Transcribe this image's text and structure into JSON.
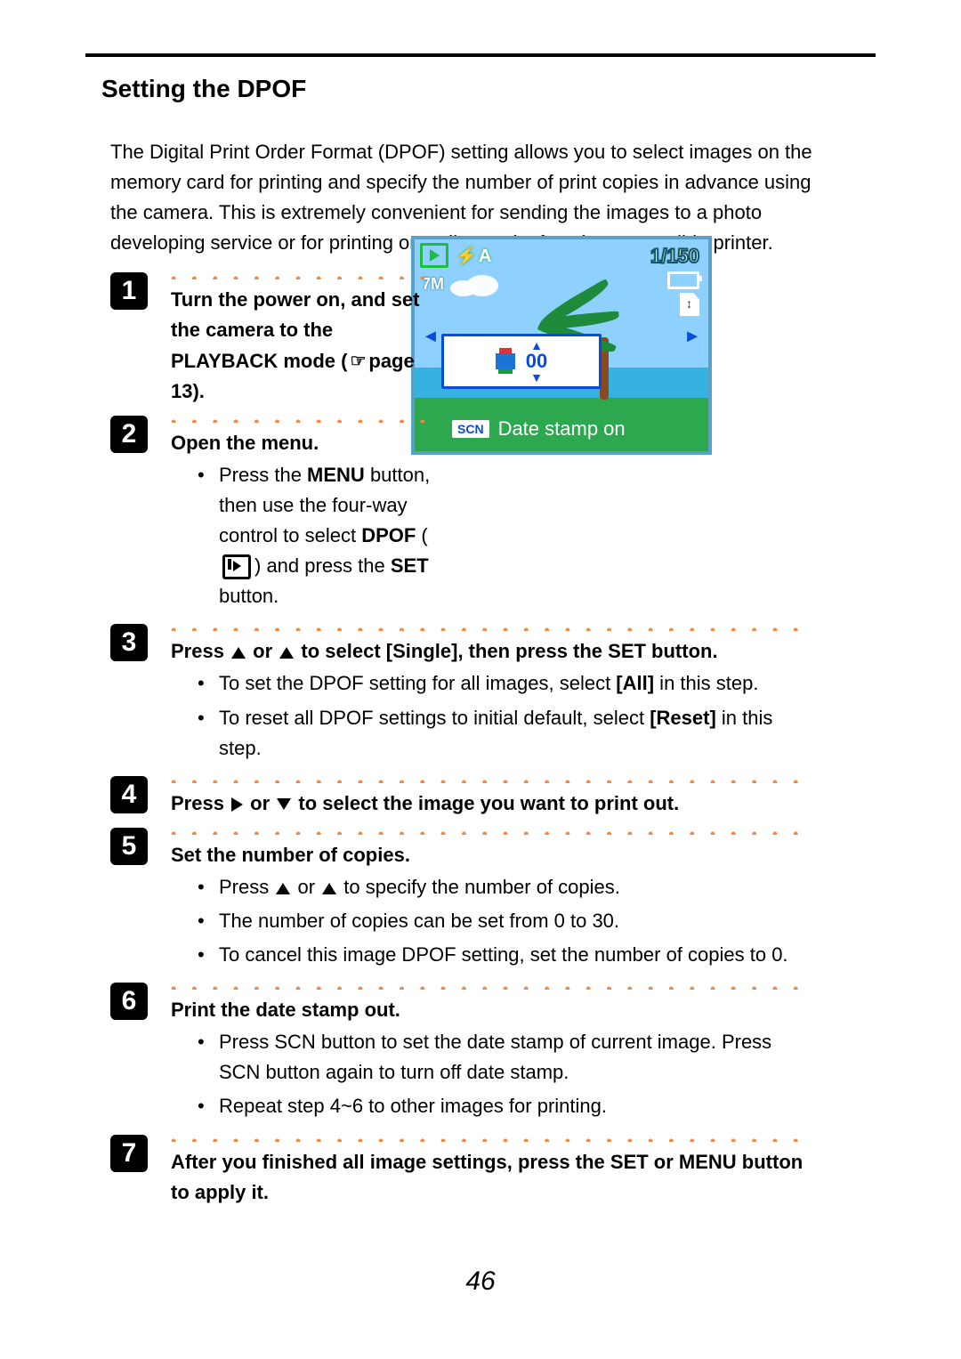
{
  "title": "Setting the DPOF",
  "intro": "The Digital Print Order Format (DPOF) setting allows you to select images on the memory card for printing and specify the number of print copies in advance using the camera. This is extremely convenient for sending the images to a photo developing service or for printing on a direct print function compatible printer.",
  "page_number": "46",
  "dots_short": "•  •  •  •  •  •  •  •  •  •  •  •  •  •  •  •  •  •  •  •  •  •  •  •  •  •  •  •  •",
  "dots_long": "•  •  •  •  •  •  •  •  •  •  •  •  •  •  •  •  •  •  •  •  •  •  •  •  •  •  •  •  •  •  •  •  •  •  •  •  •  •  •  •  •  •  •  •  •  •  •  •  •  •  •  •  •  •  •  •  •  •  •  •  •  •  •  •  •  •  •  •",
  "steps": {
    "s1": {
      "n": "1",
      "head_a": "Turn the power on, and set the camera to the PLAYBACK mode (",
      "head_b": "page 13)."
    },
    "s2": {
      "n": "2",
      "head": "Open the menu.",
      "li_a": "Press the ",
      "li_menu": "MENU",
      "li_b": " button, then use the four-way control to select ",
      "li_dpof": "DPOF",
      "li_c": " (",
      "li_d": ") and press the ",
      "li_set": "SET",
      "li_e": " button."
    },
    "s3": {
      "n": "3",
      "head_a": "Press ",
      "head_b": " or ",
      "head_c": " to select [Single], then press the SET button.",
      "li1_a": "To set the DPOF setting for all images, select ",
      "li1_b": "[All]",
      "li1_c": " in this step.",
      "li2_a": "To reset all DPOF settings to initial default, select ",
      "li2_b": "[Reset]",
      "li2_c": " in this step."
    },
    "s4": {
      "n": "4",
      "head_a": "Press ",
      "head_b": " or ",
      "head_c": " to select the image you want to print out."
    },
    "s5": {
      "n": "5",
      "head": "Set the number of copies.",
      "li1_a": "Press ",
      "li1_b": " or ",
      "li1_c": " to specify the number of copies.",
      "li2": "The number of copies can be set from 0 to 30.",
      "li3": "To cancel this image DPOF setting, set the number of copies to 0."
    },
    "s6": {
      "n": "6",
      "head": "Print the date stamp out.",
      "li1": "Press SCN button to set the date stamp of current image. Press SCN button again to turn off date stamp.",
      "li2": "Repeat step 4~6 to other images for printing."
    },
    "s7": {
      "n": "7",
      "head": "After you finished all image settings, press the SET or MENU button to apply it."
    }
  },
  "screen": {
    "flash_label": "A",
    "counter": "1/150",
    "resolution": "7M",
    "copies": "00",
    "scn_label": "SCN",
    "stamp_text": "Date stamp on"
  }
}
